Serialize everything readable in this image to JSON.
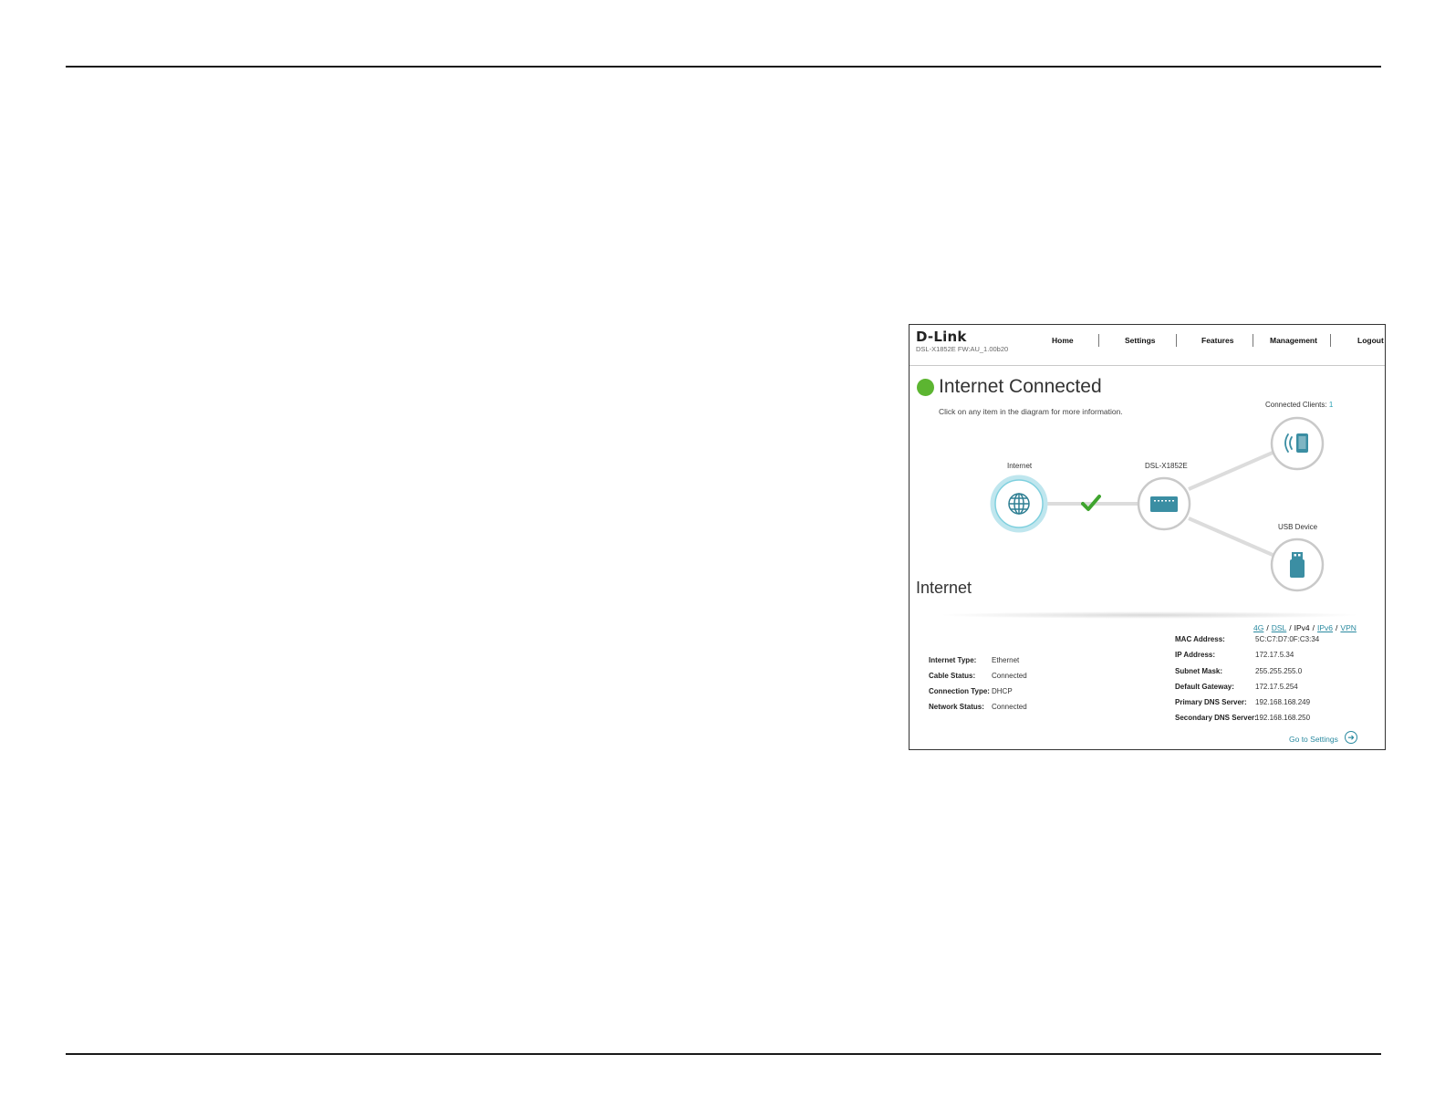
{
  "header": {
    "logo": "D-Link",
    "firmware": "DSL-X1852E  FW:AU_1.00b20",
    "nav": [
      "Home",
      "Settings",
      "Features",
      "Management",
      "Logout"
    ]
  },
  "status": {
    "title": "Internet Connected",
    "hint": "Click on any item in the diagram for more information.",
    "color": "#5cb531"
  },
  "diagram": {
    "internet_label": "Internet",
    "router_label": "DSL-X1852E",
    "clients_label": "Connected Clients:",
    "clients_count": "1",
    "usb_label": "USB Device",
    "icons": [
      "globe-icon",
      "router-icon",
      "mobile-wireless-icon",
      "usb-drive-icon",
      "check-icon"
    ]
  },
  "internet": {
    "section_title": "Internet",
    "tabs": [
      {
        "label": "4G",
        "link": true
      },
      {
        "label": "DSL",
        "link": true
      },
      {
        "label": "IPv4",
        "link": false
      },
      {
        "label": "IPv6",
        "link": true
      },
      {
        "label": "VPN",
        "link": true
      }
    ],
    "left": [
      {
        "label": "Internet Type:",
        "value": "Ethernet"
      },
      {
        "label": "Cable Status:",
        "value": "Connected"
      },
      {
        "label": "Connection Type:",
        "value": "DHCP"
      },
      {
        "label": "Network Status:",
        "value": "Connected"
      }
    ],
    "right": [
      {
        "label": "MAC Address:",
        "value": "5C:C7:D7:0F:C3:34"
      },
      {
        "label": "IP Address:",
        "value": "172.17.5.34"
      },
      {
        "label": "Subnet Mask:",
        "value": "255.255.255.0"
      },
      {
        "label": "Default Gateway:",
        "value": "172.17.5.254"
      },
      {
        "label": "Primary DNS Server:",
        "value": "192.168.168.249"
      },
      {
        "label": "Secondary DNS Server:",
        "value": "192.168.168.250"
      }
    ],
    "go_to_settings": "Go to Settings"
  }
}
